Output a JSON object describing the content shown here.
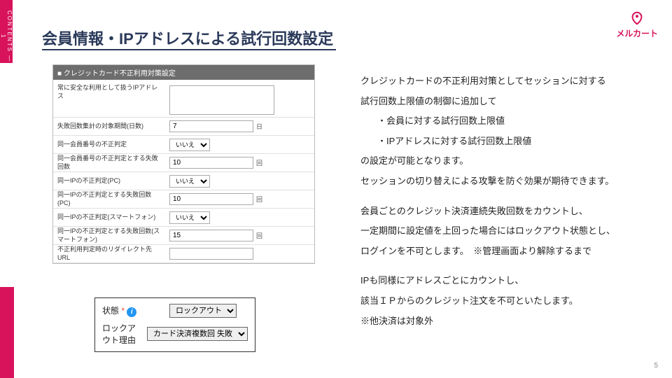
{
  "sideTab": "CONTENTS — 1",
  "title": "会員情報・IPアドレスによる試行回数設定",
  "logo": {
    "text": "メルカート"
  },
  "panel": {
    "header": "■ クレジットカード不正利用対策設定",
    "rows": [
      {
        "label": "常に安全な利用として扱うIPアドレス",
        "type": "textarea",
        "value": ""
      },
      {
        "label": "失敗回数集計の対象期間(日数)",
        "type": "text",
        "value": "7",
        "unit": "日"
      },
      {
        "label": "同一会員番号の不正判定",
        "type": "select",
        "value": "いいえ"
      },
      {
        "label": "同一会員番号の不正判定とする失敗回数",
        "type": "text",
        "value": "10",
        "unit": "回"
      },
      {
        "label": "同一IPの不正判定(PC)",
        "type": "select",
        "value": "いいえ"
      },
      {
        "label": "同一IPの不正判定とする失敗回数(PC)",
        "type": "text",
        "value": "10",
        "unit": "回"
      },
      {
        "label": "同一IPの不正判定(スマートフォン)",
        "type": "select",
        "value": "いいえ"
      },
      {
        "label": "同一IPの不正判定とする失敗回数(スマートフォン)",
        "type": "text",
        "value": "15",
        "unit": "回"
      },
      {
        "label": "不正利用判定時のリダイレクト先URL",
        "type": "text",
        "value": "",
        "unit": ""
      }
    ]
  },
  "status": {
    "label1": "状態",
    "req": "*",
    "select1": "ロックアウト",
    "label2": "ロックアウト理由",
    "select2": "カード決済複数回 失敗"
  },
  "desc": {
    "l1": "クレジットカードの不正利用対策としてセッションに対する",
    "l2": "試行回数上限値の制御に追加して",
    "l3": "・会員に対する試行回数上限値",
    "l4": "・IPアドレスに対する試行回数上限値",
    "l5": "の設定が可能となります。",
    "l6": "セッションの切り替えによる攻撃を防ぐ効果が期待できます。",
    "l7": "会員ごとのクレジット決済連続失敗回数をカウントし、",
    "l8": "一定期間に設定値を上回った場合にはロックアウト状態とし、",
    "l9": "ログインを不可とします。　※管理画面より解除するまで",
    "l10": "IPも同様にアドレスごとにカウントし、",
    "l11": "該当ＩＰからのクレジット注文を不可といたします。",
    "l12": "※他決済は対象外"
  },
  "pageNum": "5"
}
